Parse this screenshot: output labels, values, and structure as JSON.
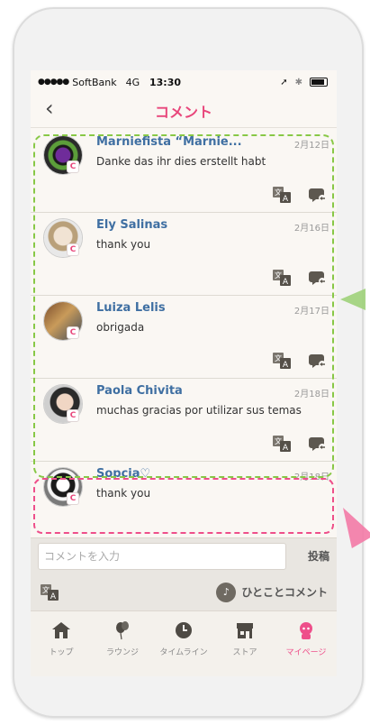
{
  "status_bar": {
    "signal": "●●●●●",
    "carrier": "SoftBank",
    "network": "4G",
    "time": "13:30",
    "location": "➚",
    "bluetooth": "✱"
  },
  "header": {
    "back_label": "‹",
    "title": "コメント"
  },
  "comments": [
    {
      "name": "Marniefista “Marnie...",
      "date": "2月12日",
      "text": "Danke das ihr dies erstellt habt",
      "badge": "C"
    },
    {
      "name": "Ely Salinas",
      "date": "2月16日",
      "text": "thank you",
      "badge": "C"
    },
    {
      "name": "Luiza Lelis",
      "date": "2月17日",
      "text": "obrigada",
      "badge": "C"
    },
    {
      "name": "Paola Chivita",
      "date": "2月18日",
      "text": "muchas gracias por utilizar sus temas",
      "badge": "C"
    },
    {
      "name": "Sopcia♡",
      "date": "2月18日",
      "text": "thank you",
      "badge": "C"
    }
  ],
  "input": {
    "placeholder": "コメントを入力",
    "post_label": "投稿"
  },
  "toolbar": {
    "hitokoto_label": "ひとことコメント"
  },
  "tabs": [
    {
      "label": "トップ",
      "icon": "home-icon"
    },
    {
      "label": "ラウンジ",
      "icon": "balloon-icon"
    },
    {
      "label": "タイムライン",
      "icon": "clock-icon"
    },
    {
      "label": "ストア",
      "icon": "store-icon"
    },
    {
      "label": "マイページ",
      "icon": "mypage-icon"
    }
  ],
  "colors": {
    "accent": "#e8467b",
    "name": "#3f6fa2",
    "highlight_green": "#88c846",
    "highlight_pink": "#ee4f8a"
  }
}
